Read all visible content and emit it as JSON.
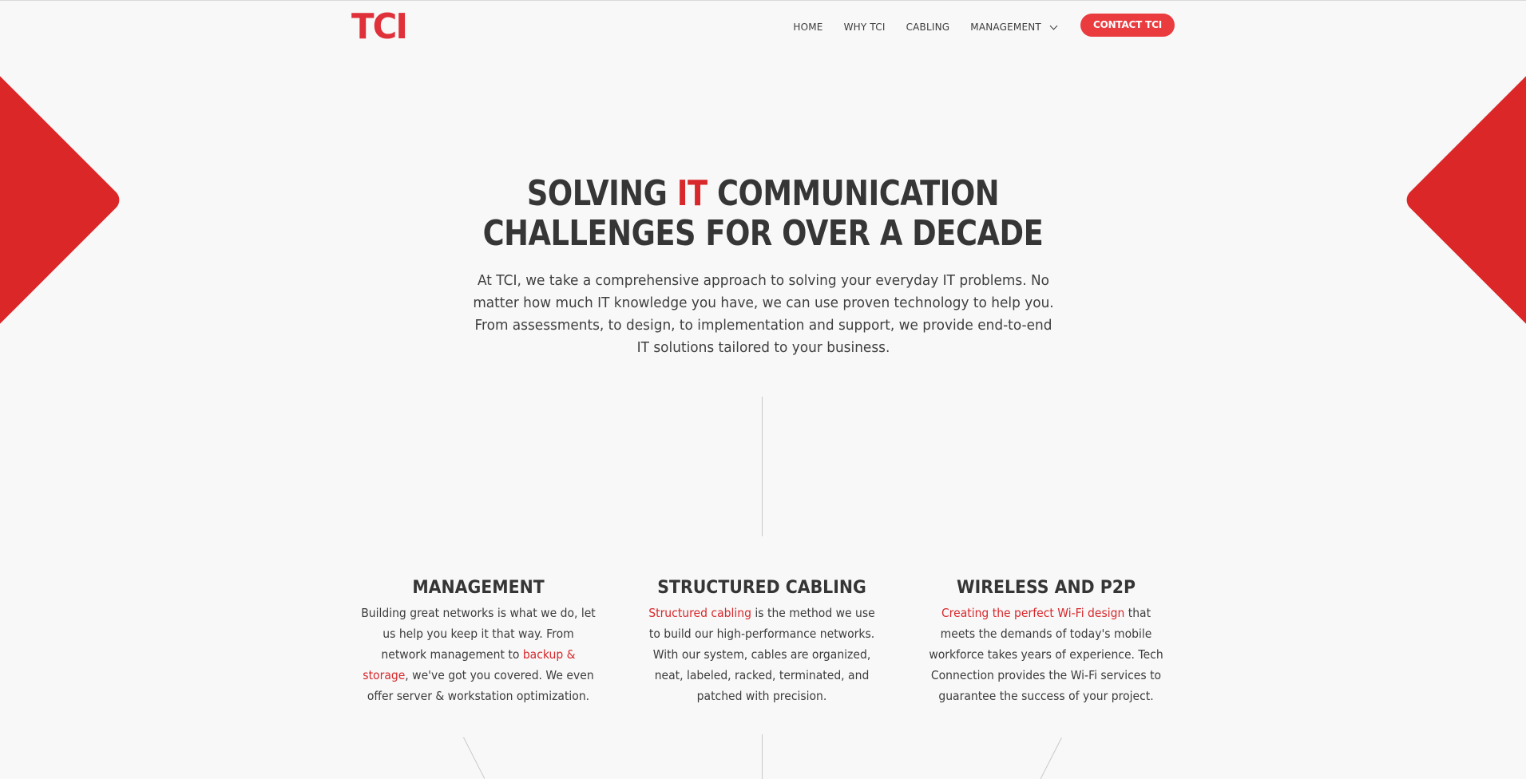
{
  "header": {
    "logo": "TCI",
    "nav": [
      {
        "label": "HOME"
      },
      {
        "label": "WHY TCI"
      },
      {
        "label": "CABLING"
      },
      {
        "label": "MANAGEMENT"
      }
    ],
    "contact_label": "CONTACT TCI"
  },
  "hero": {
    "title_part1": "SOLVING ",
    "title_accent": "IT",
    "title_part2": " COMMUNICATION",
    "title_line2": "CHALLENGES FOR OVER A DECADE",
    "body": "At TCI, we take a comprehensive approach to solving your everyday IT problems. No matter how much IT knowledge you have, we can use proven technology to help you. From assessments, to design, to implementation and support, we provide end-to-end IT solutions tailored to your business."
  },
  "features": [
    {
      "title": "MANAGEMENT",
      "text_before": "Building great networks is what we do, let us help you keep it that way. From network management to ",
      "link": "backup & storage",
      "text_after": ", we've got you covered. We even offer server & workstation optimization."
    },
    {
      "title": "STRUCTURED CABLING",
      "text_before": "",
      "link": "Structured cabling",
      "text_after": " is the method we use to build our high-performance networks. With our system, cables are organized, neat, labeled, racked, terminated, and patched with precision."
    },
    {
      "title": "WIRELESS AND P2P",
      "text_before": "",
      "link": "Creating the perfect Wi-Fi design",
      "text_after": " that meets the demands of today's mobile workforce takes years of experience. Tech Connection provides the Wi-Fi services to guarantee the success of your project."
    }
  ],
  "colors": {
    "accent": "#d8282b",
    "button": "#ea3b3f",
    "background": "#f8f8f8",
    "text": "#3a3a3a"
  }
}
